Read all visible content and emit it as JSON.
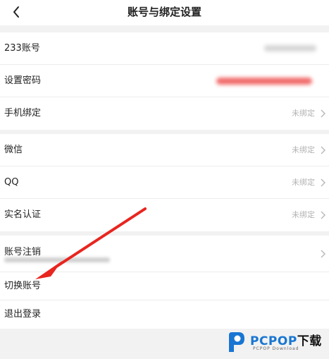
{
  "header": {
    "title": "账号与绑定设置",
    "back_icon": "chevron-left-icon"
  },
  "groups": [
    {
      "rows": [
        {
          "label": "233账号",
          "value": ""
        },
        {
          "label": "设置密码",
          "value": ""
        },
        {
          "label": "手机绑定",
          "value": "未绑定"
        }
      ]
    },
    {
      "rows": [
        {
          "label": "微信",
          "value": "未绑定"
        },
        {
          "label": "QQ",
          "value": "未绑定"
        },
        {
          "label": "实名认证",
          "value": "未绑定"
        }
      ]
    },
    {
      "rows": [
        {
          "label": "账号注销"
        },
        {
          "label": "切换账号"
        },
        {
          "label": "退出登录"
        }
      ]
    }
  ],
  "watermark": {
    "brand": "PCPOP",
    "brand_suffix": "下载",
    "subtitle": "PCPOP Download"
  },
  "colors": {
    "arrow": "#e8251f",
    "brand_blue": "#1976d2",
    "background": "#f2f2f2"
  }
}
